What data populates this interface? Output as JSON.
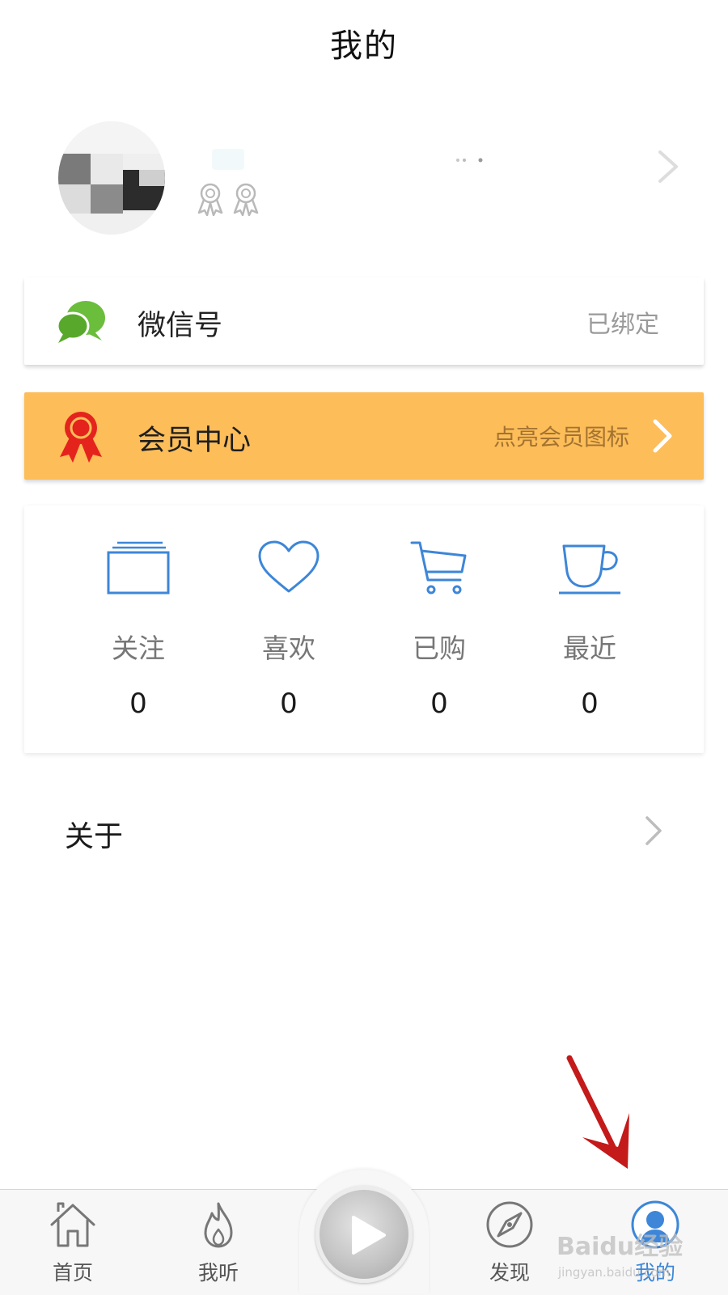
{
  "header": {
    "title": "我的"
  },
  "profile": {
    "avatar": "blurred-user-avatar",
    "badges": [
      "award-badge-icon",
      "award-badge-icon"
    ]
  },
  "rows": {
    "wechat": {
      "label": "微信号",
      "status": "已绑定",
      "icon": "wechat-icon",
      "color": "#6bbd3c"
    },
    "member": {
      "label": "会员中心",
      "hint": "点亮会员图标",
      "icon": "member-ribbon-icon",
      "background": "#fdbd59",
      "icon_color": "#e5231d"
    }
  },
  "stats": {
    "accent": "#3d86d8",
    "items": [
      {
        "label": "关注",
        "value": "0",
        "icon": "folder-icon"
      },
      {
        "label": "喜欢",
        "value": "0",
        "icon": "heart-icon"
      },
      {
        "label": "已购",
        "value": "0",
        "icon": "cart-icon"
      },
      {
        "label": "最近",
        "value": "0",
        "icon": "cup-icon"
      }
    ]
  },
  "about": {
    "label": "关于"
  },
  "tabbar": {
    "active_color": "#3d86d8",
    "items": [
      {
        "label": "首页",
        "icon": "home-icon"
      },
      {
        "label": "我听",
        "icon": "flame-icon"
      },
      {
        "label": "",
        "icon": "play-icon"
      },
      {
        "label": "发现",
        "icon": "compass-icon"
      },
      {
        "label": "我的",
        "icon": "user-icon",
        "active": true
      }
    ]
  },
  "watermark": {
    "main": "Baidu经验",
    "sub": "jingyan.baidu.com"
  },
  "annotation": {
    "icon": "red-arrow-icon",
    "color": "#c41a1a"
  }
}
